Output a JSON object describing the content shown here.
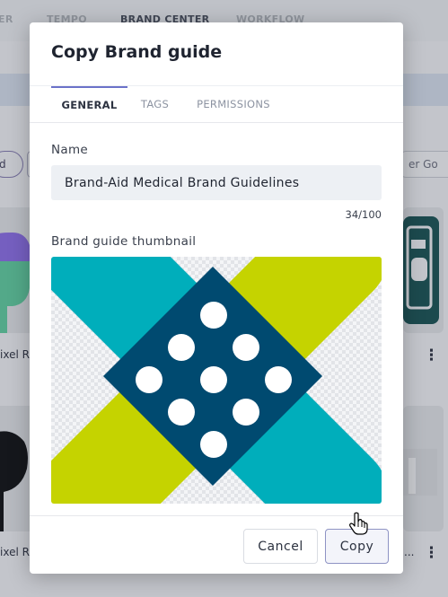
{
  "background": {
    "nav": [
      "ER",
      "TEMPO",
      "BRAND CENTER",
      "WORKFLOW"
    ],
    "chip_left": "d",
    "chip_right": "er Go",
    "card_labels": [
      "ixel R",
      "ixel R",
      "..."
    ]
  },
  "modal": {
    "title": "Copy Brand guide",
    "tabs": [
      {
        "label": "GENERAL",
        "active": true
      },
      {
        "label": "TAGS",
        "active": false
      },
      {
        "label": "PERMISSIONS",
        "active": false
      }
    ],
    "name": {
      "label": "Name",
      "value": "Brand-Aid Medical Brand Guidelines",
      "counter": "34/100"
    },
    "thumbnail": {
      "label": "Brand guide thumbnail",
      "icon": "adhesive-bandage-icon",
      "colors": {
        "lime": "#c5d300",
        "teal": "#00aebb",
        "navy": "#004a70",
        "dot": "#ffffff"
      }
    },
    "footer": {
      "cancel_label": "Cancel",
      "copy_label": "Copy"
    }
  },
  "colors": {
    "accent": "#6b72c9",
    "input_bg": "#edf0f4"
  }
}
